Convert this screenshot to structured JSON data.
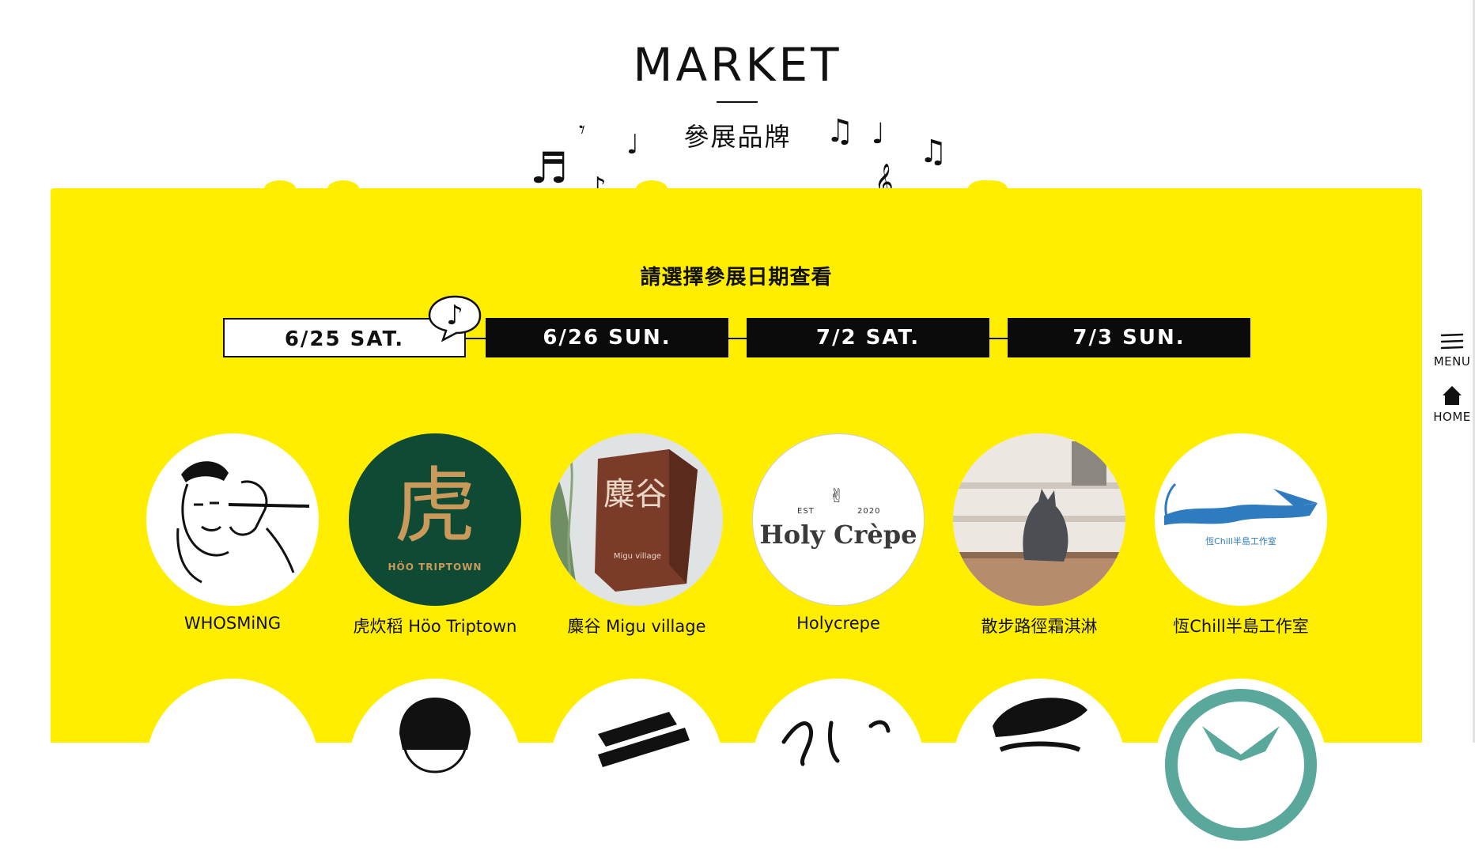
{
  "header": {
    "title_en": "MARKET",
    "title_zh": "參展品牌"
  },
  "panel": {
    "subtitle": "請選擇參展日期查看",
    "tabs": [
      {
        "label": "6/25 SAT.",
        "active": true
      },
      {
        "label": "6/26 SUN.",
        "active": false
      },
      {
        "label": "7/2 SAT.",
        "active": false
      },
      {
        "label": "7/3 SUN.",
        "active": false
      }
    ],
    "brands_row1": [
      {
        "name": "WHOSMiNG"
      },
      {
        "name": "虎炊稻 Höo Triptown",
        "logo_text": "虎",
        "logo_sub": "HÖO TRIPTOWN"
      },
      {
        "name": "麋谷 Migu village",
        "logo_text": "麋谷",
        "logo_sub": "Migu village"
      },
      {
        "name": "Holycrepe",
        "logo_text": "Holy Crèpe",
        "logo_est": "EST",
        "logo_year": "2020"
      },
      {
        "name": "散步路徑霜淇淋"
      },
      {
        "name": "恆Chill半島工作室",
        "logo_text": "恆Chill半島工作室"
      }
    ]
  },
  "side_nav": {
    "menu_label": "MENU",
    "home_label": "HOME"
  },
  "colors": {
    "panel_yellow": "#ffee00",
    "ink": "#111111",
    "brand_green": "#0f4a34",
    "brand_gold": "#c99a5a",
    "brand_blue": "#2f7bbf",
    "teal": "#5aa89b"
  },
  "icons": {
    "menu": "hamburger-menu-icon",
    "home": "home-icon",
    "note": "music-note-icon"
  }
}
